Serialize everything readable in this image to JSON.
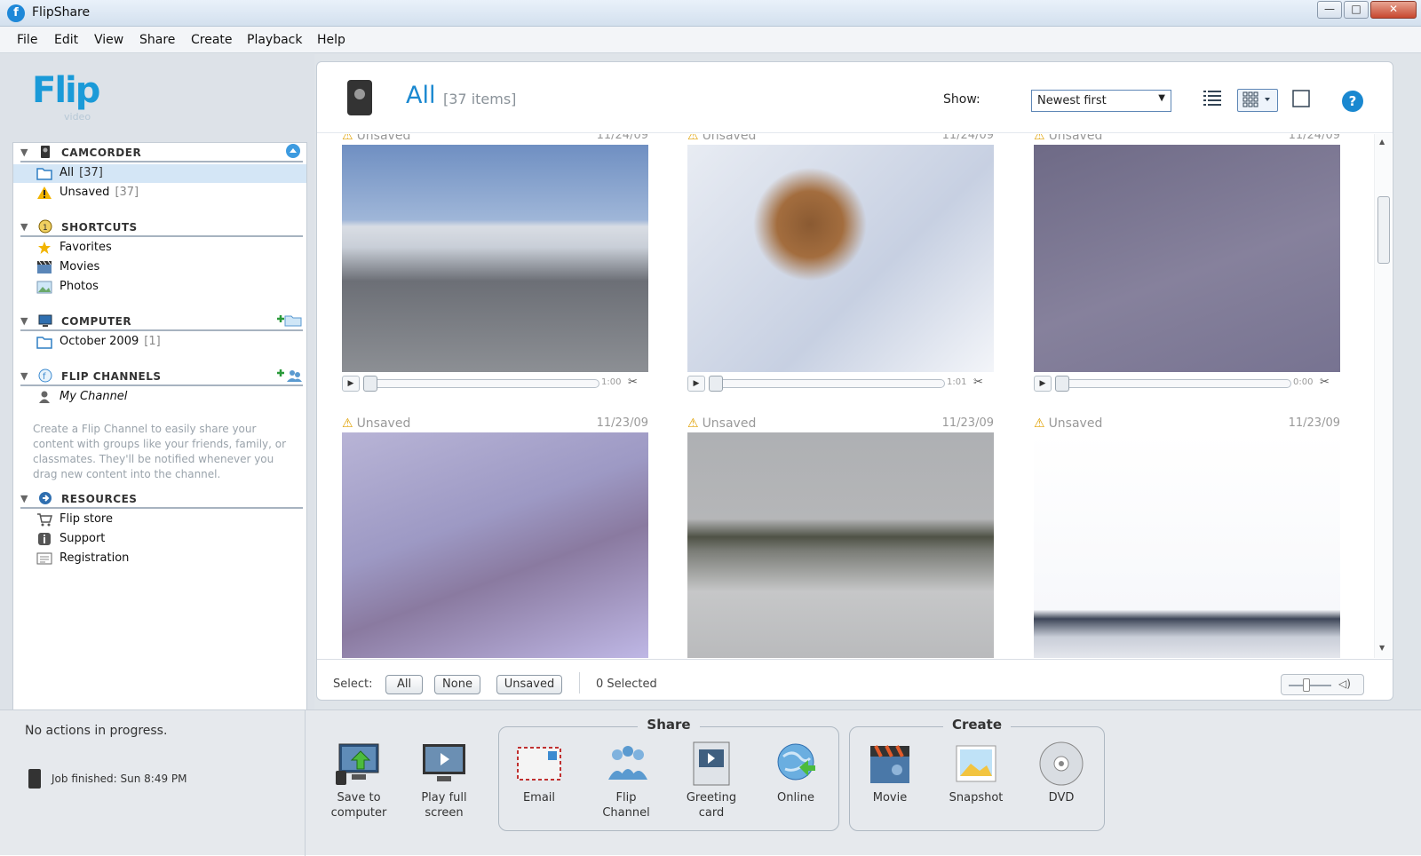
{
  "window": {
    "title": "FlipShare"
  },
  "menu": [
    "File",
    "Edit",
    "View",
    "Share",
    "Create",
    "Playback",
    "Help"
  ],
  "logo": {
    "text": "Flip",
    "sub": "video"
  },
  "sidebar": {
    "camcorder": {
      "title": "CAMCORDER",
      "items": [
        {
          "label": "All",
          "count": "[37]"
        },
        {
          "label": "Unsaved",
          "count": "[37]"
        }
      ]
    },
    "shortcuts": {
      "title": "SHORTCUTS",
      "items": [
        {
          "label": "Favorites"
        },
        {
          "label": "Movies"
        },
        {
          "label": "Photos"
        }
      ]
    },
    "computer": {
      "title": "COMPUTER",
      "items": [
        {
          "label": "October 2009",
          "count": "[1]"
        }
      ]
    },
    "channels": {
      "title": "FLIP CHANNELS",
      "items": [
        {
          "label": "My Channel"
        }
      ],
      "description": "Create a Flip Channel to easily share your content with groups like your friends, family, or classmates. They'll be notified whenever you drag new content into the channel."
    },
    "resources": {
      "title": "RESOURCES",
      "items": [
        {
          "label": "Flip store"
        },
        {
          "label": "Support"
        },
        {
          "label": "Registration"
        }
      ]
    }
  },
  "content": {
    "title": "All",
    "count": "[37 items]",
    "show_label": "Show:",
    "sort_value": "Newest first",
    "tiles": [
      {
        "status": "Unsaved",
        "date": "11/24/09",
        "duration": "1:00",
        "scene": "road"
      },
      {
        "status": "Unsaved",
        "date": "11/24/09",
        "duration": "1:01",
        "scene": "dog"
      },
      {
        "status": "Unsaved",
        "date": "11/24/09",
        "duration": "0:00",
        "scene": "purple"
      },
      {
        "status": "Unsaved",
        "date": "11/23/09",
        "duration": "",
        "scene": "car"
      },
      {
        "status": "Unsaved",
        "date": "11/23/09",
        "duration": "",
        "scene": "field"
      },
      {
        "status": "Unsaved",
        "date": "11/23/09",
        "duration": "",
        "scene": "white"
      }
    ],
    "select_label": "Select:",
    "select_all": "All",
    "select_none": "None",
    "select_unsaved": "Unsaved",
    "selected_count": "0 Selected"
  },
  "status": {
    "text": "No actions in progress.",
    "job": "Job finished: Sun 8:49 PM"
  },
  "actions": {
    "save": "Save to computer",
    "play": "Play full screen",
    "share_title": "Share",
    "email": "Email",
    "flip_channel": "Flip Channel",
    "greeting": "Greeting card",
    "online": "Online",
    "create_title": "Create",
    "movie": "Movie",
    "snapshot": "Snapshot",
    "dvd": "DVD"
  },
  "colors": {
    "accent": "#1a88d0",
    "warning": "#e0a000",
    "selection": "#d4e6f6"
  }
}
